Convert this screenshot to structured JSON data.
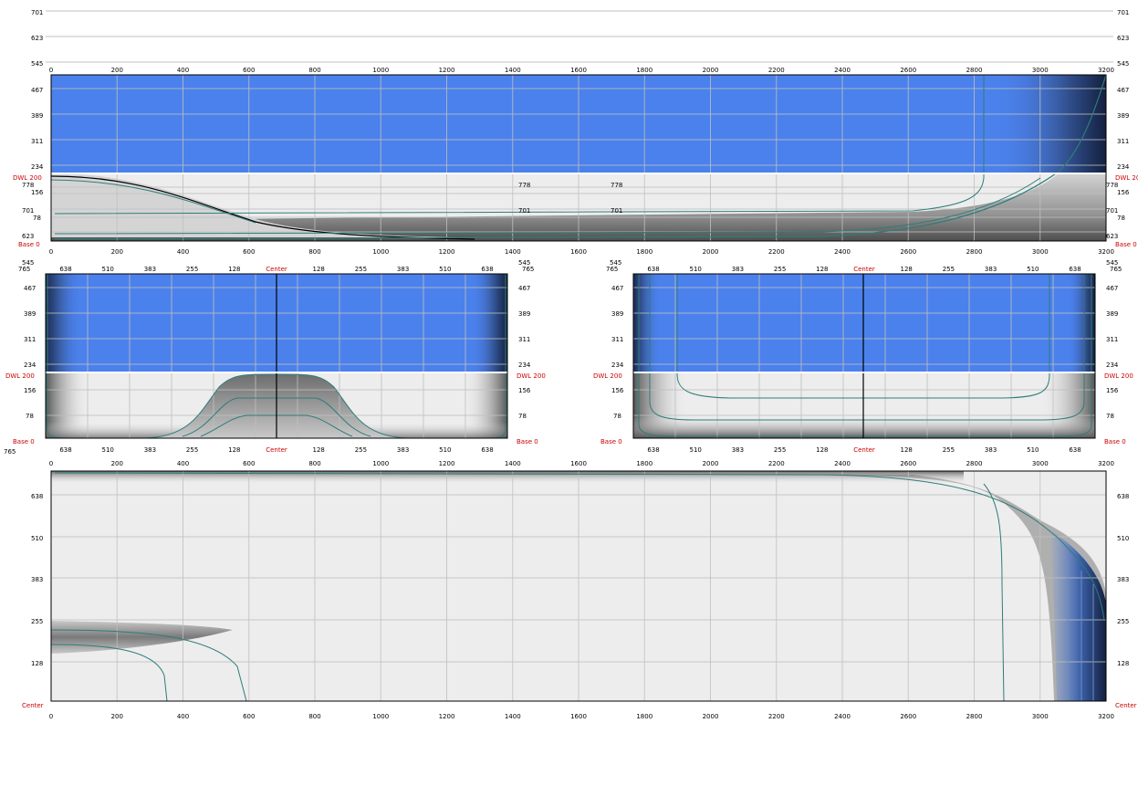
{
  "colors": {
    "above_dwl_fill": "#4b81ec",
    "below_dwl_fill": "#ededed",
    "contour_line": "#2e7d7a",
    "grid": "#c0c0c0",
    "red_label": "#cc0000",
    "dark_gradient": "#1a2c57"
  },
  "top_band": {
    "left_labels": [
      "701",
      "623",
      "545"
    ],
    "right_labels": [
      "701",
      "623",
      "545"
    ]
  },
  "profile_view": {
    "x_ticks": [
      "0",
      "200",
      "400",
      "600",
      "800",
      "1000",
      "1200",
      "1400",
      "1600",
      "1800",
      "2000",
      "2200",
      "2400",
      "2600",
      "2800",
      "3000",
      "3200"
    ],
    "upper_y_labels": [
      "467",
      "389",
      "311",
      "234"
    ],
    "dwl_label": "DWL 200",
    "lower_y_labels": [
      "778",
      "156",
      "701",
      "78",
      "623"
    ],
    "base_label": "Base 0",
    "inner_labels": [
      "778",
      "778",
      "701",
      "701"
    ]
  },
  "section_views": {
    "left_view": {
      "corner_top": "545",
      "corner_bottom": "765",
      "top_ticks": [
        "638",
        "510",
        "383",
        "255",
        "128",
        "Center",
        "128",
        "255",
        "383",
        "510",
        "638"
      ],
      "y_labels": [
        "467",
        "389",
        "311",
        "234"
      ],
      "dwl_label": "DWL 200",
      "lower_y_labels": [
        "156",
        "78"
      ],
      "base_label": "Base 0"
    },
    "right_view": {
      "corner_top": "545",
      "corner_bottom": "765",
      "top_ticks": [
        "638",
        "510",
        "383",
        "255",
        "128",
        "Center",
        "128",
        "255",
        "383",
        "510",
        "638"
      ],
      "y_labels": [
        "467",
        "389",
        "311",
        "234"
      ],
      "dwl_label": "DWL 200",
      "lower_y_labels": [
        "156",
        "78"
      ],
      "base_label": "Base 0"
    }
  },
  "plan_view": {
    "x_ticks": [
      "0",
      "200",
      "400",
      "600",
      "800",
      "1000",
      "1200",
      "1400",
      "1600",
      "1800",
      "2000",
      "2200",
      "2400",
      "2600",
      "2800",
      "3000",
      "3200"
    ],
    "y_labels": [
      "638",
      "510",
      "383",
      "255",
      "128"
    ],
    "center_label": "Center"
  }
}
